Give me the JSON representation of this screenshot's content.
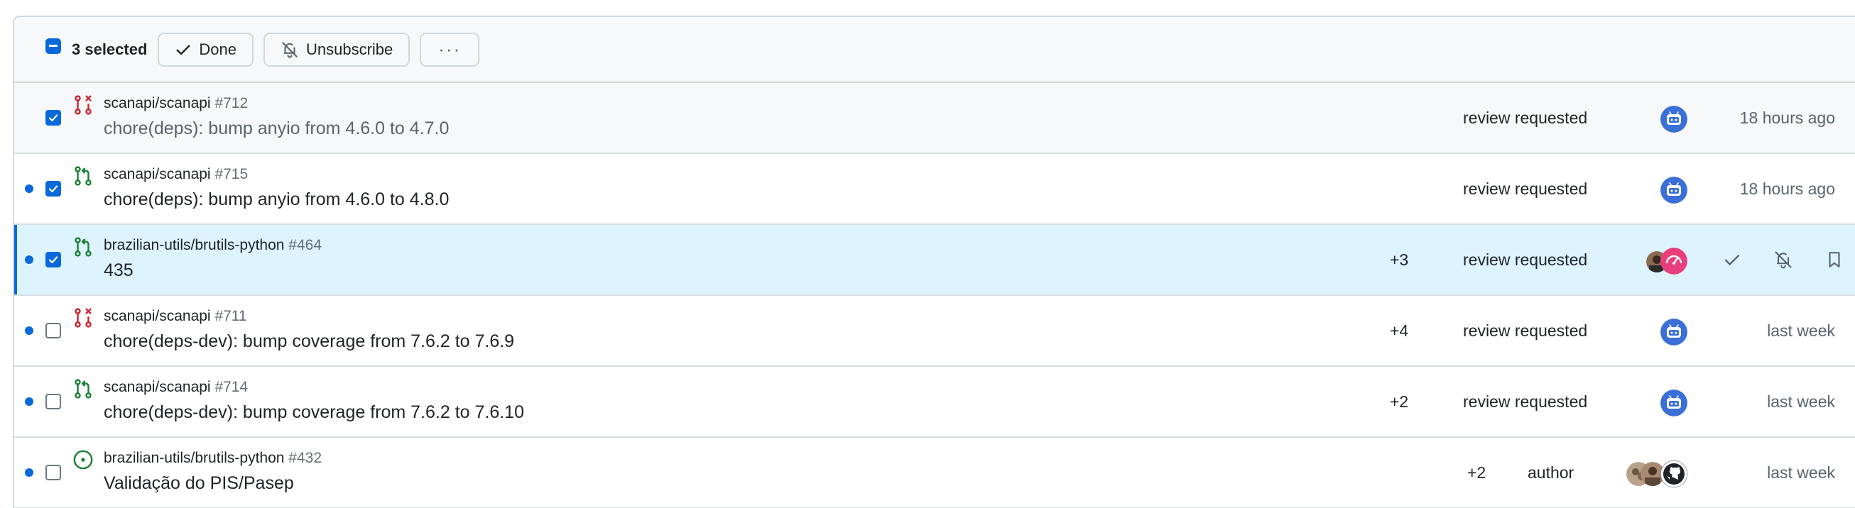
{
  "toolbar": {
    "selected_label": "3 selected",
    "done_label": "Done",
    "unsubscribe_label": "Unsubscribe",
    "more_label": "···"
  },
  "colors": {
    "accent": "#0969da",
    "open_pr": "#1a7f37",
    "closed_pr": "#cf222e",
    "active_row": "#ddf4ff"
  },
  "rows": [
    {
      "repo": "scanapi/scanapi",
      "number": "#712",
      "title": "chore(deps): bump anyio from 4.6.0 to 4.7.0",
      "count": "",
      "reason": "review requested",
      "time": "18 hours ago",
      "unread": false,
      "checked": true,
      "type_icon": "closed-pull-request-icon"
    },
    {
      "repo": "scanapi/scanapi",
      "number": "#715",
      "title": "chore(deps): bump anyio from 4.6.0 to 4.8.0",
      "count": "",
      "reason": "review requested",
      "time": "18 hours ago",
      "unread": true,
      "checked": true,
      "type_icon": "open-pull-request-icon"
    },
    {
      "repo": "brazilian-utils/brutils-python",
      "number": "#464",
      "title": "435",
      "count": "+3",
      "reason": "review requested",
      "time": "",
      "unread": true,
      "checked": true,
      "type_icon": "open-pull-request-icon"
    },
    {
      "repo": "scanapi/scanapi",
      "number": "#711",
      "title": "chore(deps-dev): bump coverage from 7.6.2 to 7.6.9",
      "count": "+4",
      "reason": "review requested",
      "time": "last week",
      "unread": true,
      "checked": false,
      "type_icon": "closed-pull-request-icon"
    },
    {
      "repo": "scanapi/scanapi",
      "number": "#714",
      "title": "chore(deps-dev): bump coverage from 7.6.2 to 7.6.10",
      "count": "+2",
      "reason": "review requested",
      "time": "last week",
      "unread": true,
      "checked": false,
      "type_icon": "open-pull-request-icon"
    },
    {
      "repo": "brazilian-utils/brutils-python",
      "number": "#432",
      "title": "Validação do PIS/Pasep",
      "count": "+2",
      "reason": "author",
      "time": "last week",
      "unread": true,
      "checked": false,
      "type_icon": "open-issue-icon"
    }
  ]
}
